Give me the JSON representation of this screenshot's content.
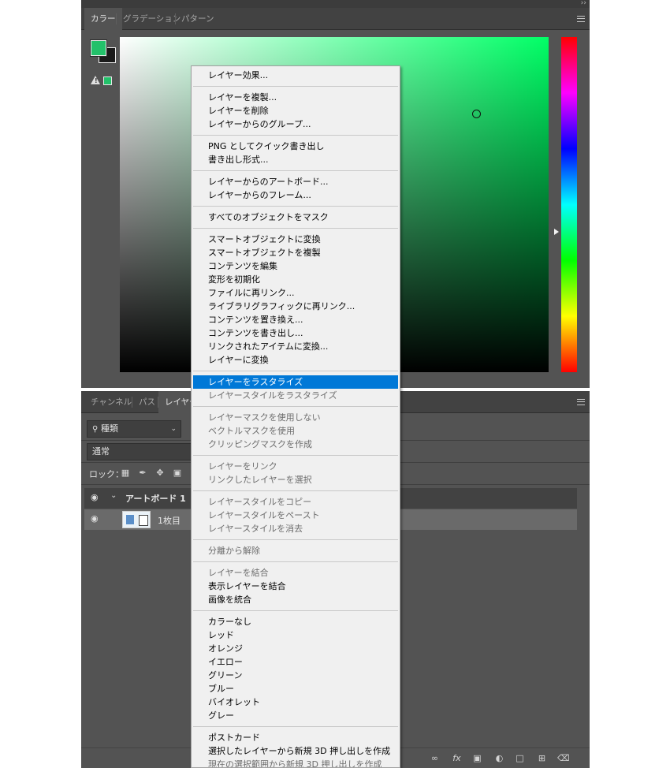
{
  "color_panel": {
    "collapse_label": "››",
    "tabs": [
      "カラー",
      "グラデーション",
      "パターン"
    ],
    "active_tab": "カラー",
    "foreground_color": "#23c16a",
    "background_color": "#1a1a1a",
    "warning_glyph": "!",
    "hue_marker_value": 0.58
  },
  "layers_panel": {
    "tabs": [
      "チャンネル",
      "パス",
      "レイヤー"
    ],
    "active_tab": "レイヤー",
    "filter_label": "種類",
    "filter_icon": "search-icon",
    "blend_mode": "通常",
    "lock_label": "ロック：",
    "artboard_name": "アートボード 1",
    "layer_name": "1枚目",
    "footer_icons": [
      "link-icon",
      "fx-icon",
      "mask-icon",
      "adjustment-icon",
      "folder-icon",
      "new-layer-icon",
      "trash-icon"
    ]
  },
  "context_menu": {
    "highlight_color": "#0078d7",
    "groups": [
      [
        {
          "label": "レイヤー効果...",
          "enabled": true
        }
      ],
      [
        {
          "label": "レイヤーを複製...",
          "enabled": true
        },
        {
          "label": "レイヤーを削除",
          "enabled": true
        },
        {
          "label": "レイヤーからのグループ...",
          "enabled": true
        }
      ],
      [
        {
          "label": "PNG としてクイック書き出し",
          "enabled": true
        },
        {
          "label": "書き出し形式...",
          "enabled": true
        }
      ],
      [
        {
          "label": "レイヤーからのアートボード...",
          "enabled": true
        },
        {
          "label": "レイヤーからのフレーム...",
          "enabled": true
        }
      ],
      [
        {
          "label": "すべてのオブジェクトをマスク",
          "enabled": true
        }
      ],
      [
        {
          "label": "スマートオブジェクトに変換",
          "enabled": true
        },
        {
          "label": "スマートオブジェクトを複製",
          "enabled": true
        },
        {
          "label": "コンテンツを編集",
          "enabled": true
        },
        {
          "label": "変形を初期化",
          "enabled": true
        },
        {
          "label": "ファイルに再リンク...",
          "enabled": true
        },
        {
          "label": "ライブラリグラフィックに再リンク...",
          "enabled": true
        },
        {
          "label": "コンテンツを置き換え...",
          "enabled": true
        },
        {
          "label": "コンテンツを書き出し...",
          "enabled": true
        },
        {
          "label": "リンクされたアイテムに変換...",
          "enabled": true
        },
        {
          "label": "レイヤーに変換",
          "enabled": true
        }
      ],
      [
        {
          "label": "レイヤーをラスタライズ",
          "enabled": true,
          "highlighted": true
        },
        {
          "label": "レイヤースタイルをラスタライズ",
          "enabled": false
        }
      ],
      [
        {
          "label": "レイヤーマスクを使用しない",
          "enabled": false
        },
        {
          "label": "ベクトルマスクを使用",
          "enabled": false
        },
        {
          "label": "クリッピングマスクを作成",
          "enabled": false
        }
      ],
      [
        {
          "label": "レイヤーをリンク",
          "enabled": false
        },
        {
          "label": "リンクしたレイヤーを選択",
          "enabled": false
        }
      ],
      [
        {
          "label": "レイヤースタイルをコピー",
          "enabled": false
        },
        {
          "label": "レイヤースタイルをペースト",
          "enabled": false
        },
        {
          "label": "レイヤースタイルを消去",
          "enabled": false
        }
      ],
      [
        {
          "label": "分離から解除",
          "enabled": false
        }
      ],
      [
        {
          "label": "レイヤーを結合",
          "enabled": false
        },
        {
          "label": "表示レイヤーを結合",
          "enabled": true
        },
        {
          "label": "画像を統合",
          "enabled": true
        }
      ],
      [
        {
          "label": "カラーなし",
          "enabled": true
        },
        {
          "label": "レッド",
          "enabled": true
        },
        {
          "label": "オレンジ",
          "enabled": true
        },
        {
          "label": "イエロー",
          "enabled": true
        },
        {
          "label": "グリーン",
          "enabled": true
        },
        {
          "label": "ブルー",
          "enabled": true
        },
        {
          "label": "バイオレット",
          "enabled": true
        },
        {
          "label": "グレー",
          "enabled": true
        }
      ],
      [
        {
          "label": "ポストカード",
          "enabled": true
        },
        {
          "label": "選択したレイヤーから新規 3D 押し出しを作成",
          "enabled": true
        },
        {
          "label": "現在の選択範囲から新規 3D 押し出しを作成",
          "enabled": false
        }
      ]
    ]
  }
}
